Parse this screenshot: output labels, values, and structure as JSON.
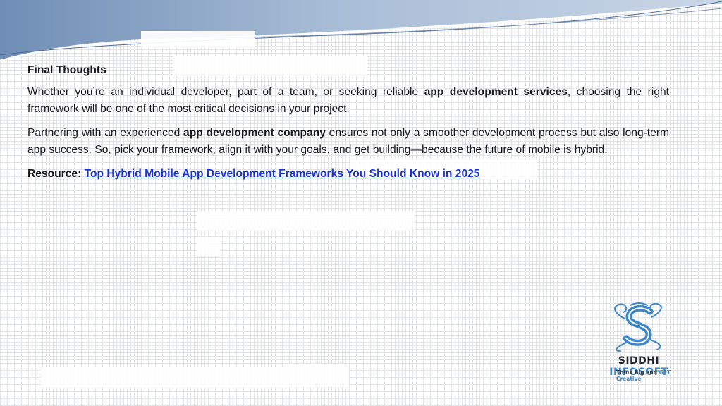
{
  "content": {
    "heading": "Final Thoughts",
    "p1": [
      {
        "text": "Whether you’re an individual developer, part of a team, or seeking reliable ",
        "bold": false
      },
      {
        "text": "app development services",
        "bold": true
      },
      {
        "text": ", choosing the right framework will be one of the most critical decisions in your project.",
        "bold": false
      }
    ],
    "p2": [
      {
        "text": "Partnering with an experienced ",
        "bold": false
      },
      {
        "text": "app development company",
        "bold": true
      },
      {
        "text": " ensures not only a smoother development process but also long-term app success. So, pick your framework, align it with your goals, and get building—because the future of mobile is hybrid.",
        "bold": false
      }
    ],
    "resource_label": "Resource:",
    "resource_link_text": "Top Hybrid Mobile App Development Frameworks You Should Know in 2025"
  },
  "logo": {
    "name_part1": "SIDDHI",
    "name_part2": "INFOSOFT",
    "tagline_part1": "Think Big and ",
    "tagline_part2": "GET Creative"
  },
  "colors": {
    "header_blue": "#8fa8c8",
    "link": "#1a35d6",
    "logo_blue": "#3d86c8",
    "logo_dark": "#222630"
  }
}
